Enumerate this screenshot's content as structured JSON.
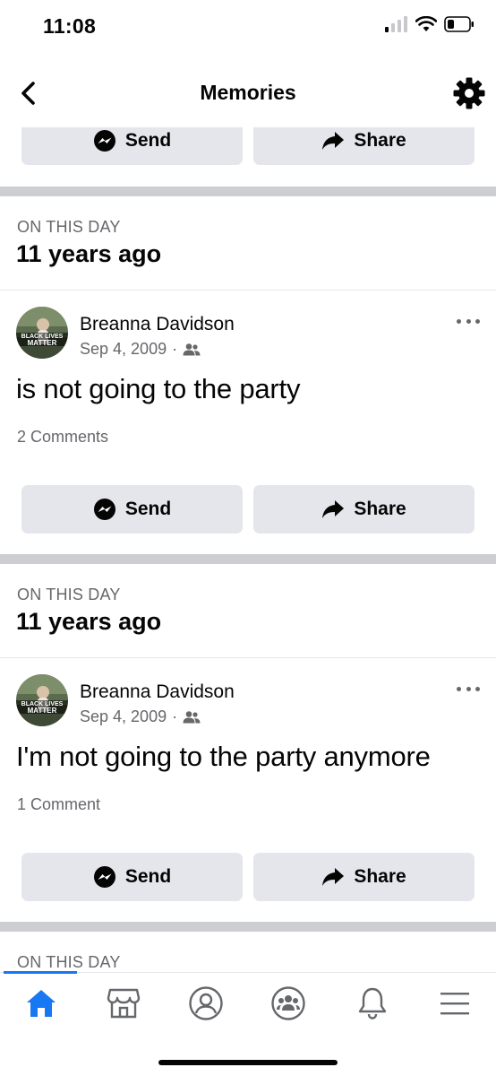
{
  "status_bar": {
    "time": "11:08"
  },
  "navbar": {
    "title": "Memories"
  },
  "buttons": {
    "send": "Send",
    "share": "Share"
  },
  "memories": [
    {
      "section_label": "ON THIS DAY",
      "years_ago": "11 years ago",
      "post": {
        "author": "Breanna Davidson",
        "date": "Sep 4, 2009",
        "separator": "·",
        "text": "is not going to the party",
        "comments": "2 Comments",
        "avatar_overlay_top": "BLACK LIVES",
        "avatar_overlay_bottom": "MATTER"
      }
    },
    {
      "section_label": "ON THIS DAY",
      "years_ago": "11 years ago",
      "post": {
        "author": "Breanna Davidson",
        "date": "Sep 4, 2009",
        "separator": "·",
        "text": "I'm not going to the party anymore",
        "comments": "1 Comment",
        "avatar_overlay_top": "BLACK LIVES",
        "avatar_overlay_bottom": "MATTER"
      }
    },
    {
      "section_label": "ON THIS DAY"
    }
  ],
  "tab_bar": {
    "tabs": [
      "home-icon",
      "marketplace-icon",
      "profile-icon",
      "groups-icon",
      "notifications-icon",
      "menu-icon"
    ],
    "active": "home-icon"
  },
  "colors": {
    "accent": "#1877f2",
    "button_bg": "#e4e6eb",
    "separator": "#cdced2",
    "secondary_text": "#65676b"
  }
}
